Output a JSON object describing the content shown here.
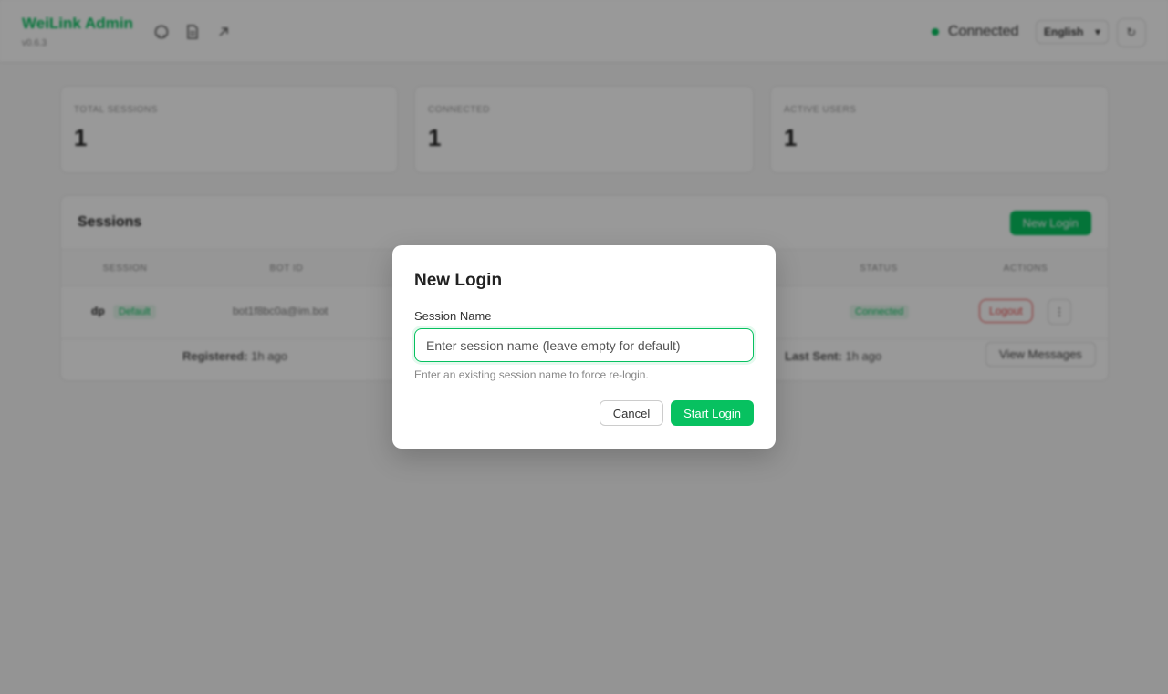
{
  "header": {
    "title": "WeiLink Admin",
    "version": "v0.6.3",
    "status": "Connected",
    "language": "English",
    "icons": [
      "github-icon",
      "docs-icon",
      "link-icon"
    ],
    "accent": "#07c160"
  },
  "stats": [
    {
      "label": "TOTAL SESSIONS",
      "value": "1"
    },
    {
      "label": "CONNECTED",
      "value": "1"
    },
    {
      "label": "ACTIVE USERS",
      "value": "1"
    }
  ],
  "sessions": {
    "title": "Sessions",
    "new_login_label": "New Login",
    "columns": [
      "SESSION",
      "BOT ID",
      "STATUS",
      "ACTIONS"
    ],
    "row": {
      "name": "dp",
      "tag": "Default",
      "bot_id": "bot1f8bc0a@im.bot",
      "status": "Connected",
      "logout_label": "Logout",
      "more_label": "⋮"
    },
    "footer": {
      "registered_label": "Registered:",
      "registered_value": "1h ago",
      "last_sent_label": "Last Sent:",
      "last_sent_value": "1h ago",
      "view_messages_label": "View Messages"
    }
  },
  "modal": {
    "title": "New Login",
    "field_label": "Session Name",
    "placeholder": "Enter session name (leave empty for default)",
    "value": "",
    "hint": "Enter an existing session name to force re-login.",
    "cancel_label": "Cancel",
    "start_label": "Start Login"
  }
}
